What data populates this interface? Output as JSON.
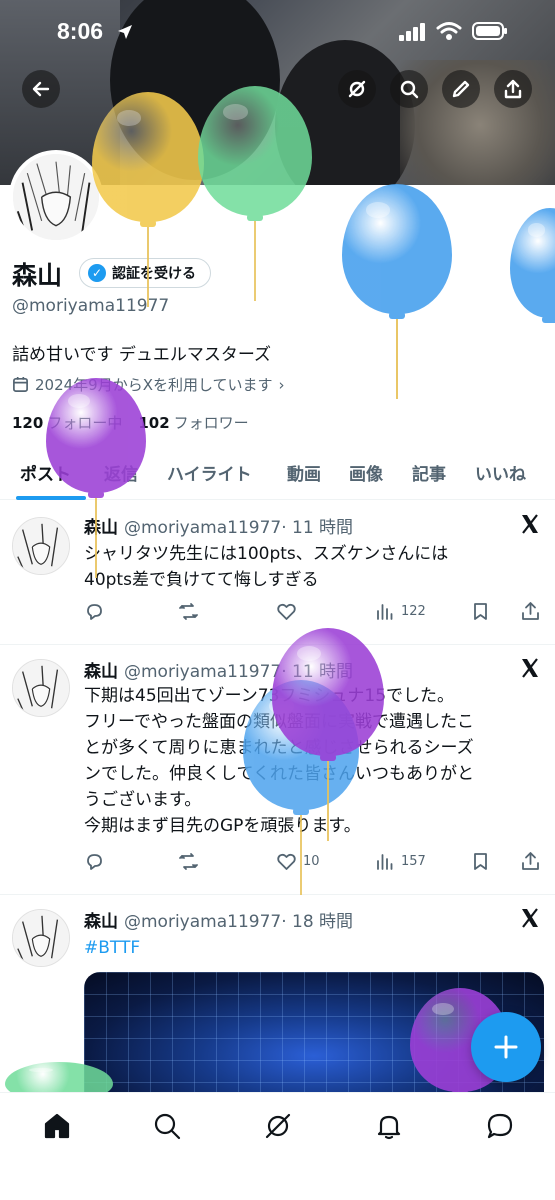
{
  "status_bar": {
    "time": "8:06"
  },
  "profile": {
    "name": "森山",
    "verify_label": "認証を受ける",
    "handle": "@moriyama11977",
    "bio": "詰め甘いです デュエルマスターズ",
    "joined": "2024年9月からXを利用しています",
    "following_count": "120",
    "following_label": "フォロー中",
    "followers_count": "102",
    "followers_label": "フォロワー"
  },
  "tabs": [
    "ポスト",
    "返信",
    "ハイライト",
    "動画",
    "画像",
    "記事",
    "いいね"
  ],
  "posts": [
    {
      "name": "森山",
      "handle": "@moriyama11977",
      "time": "· 11 時間",
      "text": "シャリタツ先生には100pts、スズケンさんには\n40pts差で負けてて悔しすぎる",
      "likes": "",
      "views": "122"
    },
    {
      "name": "森山",
      "handle": "@moriyama11977",
      "time": "· 11 時間",
      "text": "下期は45回出てゾーン73フミシュナ15でした。\nフリーでやった盤面の類似盤面に実戦で遭遇したこ\nとが多くて周りに恵まれたと感じさせられるシーズ\nンでした。仲良くしてくれた皆さんいつもありがと\nうございます。\n今期はまず目先のGPを頑張ります。",
      "likes": "10",
      "views": "157"
    },
    {
      "name": "森山",
      "handle": "@moriyama11977",
      "time": "· 18 時間",
      "text": "#BTTF"
    }
  ],
  "colors": {
    "accent": "#1d9bf0",
    "balloon_yellow": "#f2c94c",
    "balloon_green": "#6fdc9a",
    "balloon_blue": "#4da3ee",
    "balloon_purple": "#9b3fd6"
  },
  "icons": {
    "top_bar": [
      "back-arrow-icon",
      "grok-icon",
      "search-icon",
      "edit-icon",
      "share-icon"
    ],
    "bottom_nav": [
      "home-icon",
      "search-icon",
      "grok-icon",
      "bell-icon",
      "messages-icon"
    ],
    "post_actions": [
      "reply-icon",
      "repost-icon",
      "like-icon",
      "views-icon",
      "bookmark-icon",
      "share-icon"
    ]
  }
}
